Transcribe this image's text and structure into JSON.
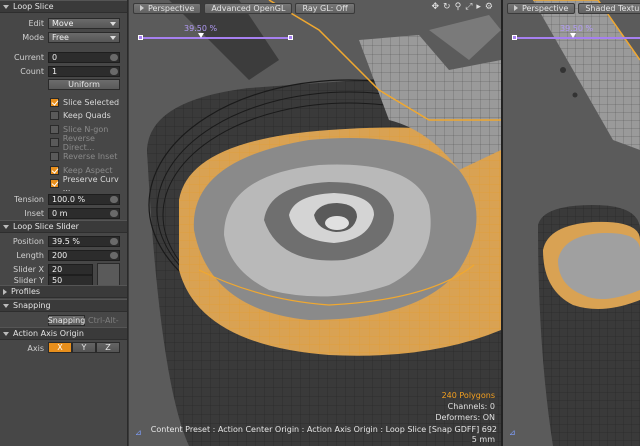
{
  "panel": {
    "loop_slice": {
      "title": "Loop Slice",
      "edit_label": "Edit",
      "edit_value": "Move",
      "mode_label": "Mode",
      "mode_value": "Free",
      "current_label": "Current",
      "current_value": "0",
      "count_label": "Count",
      "count_value": "1",
      "uniform_label": "Uniform",
      "checks": [
        {
          "label": "Slice Selected",
          "checked": true,
          "enabled": true
        },
        {
          "label": "Keep Quads",
          "checked": false,
          "enabled": true
        },
        {
          "label": "Slice N-gon",
          "checked": false,
          "enabled": false
        },
        {
          "label": "Reverse Direct...",
          "checked": false,
          "enabled": false
        },
        {
          "label": "Reverse Inset",
          "checked": false,
          "enabled": false
        },
        {
          "label": "Keep Aspect",
          "checked": true,
          "enabled": false
        },
        {
          "label": "Preserve Curv ...",
          "checked": true,
          "enabled": true
        }
      ],
      "tension_label": "Tension",
      "tension_value": "100.0 %",
      "inset_label": "Inset",
      "inset_value": "0 m"
    },
    "loop_slice_slider": {
      "title": "Loop Slice Slider",
      "position_label": "Position",
      "position_value": "39.5 %",
      "length_label": "Length",
      "length_value": "200",
      "slider_x_label": "Slider X",
      "slider_x_value": "20",
      "slider_y_label": "Slider Y",
      "slider_y_value": "50"
    },
    "profiles": {
      "title": "Profiles"
    },
    "snapping": {
      "title": "Snapping",
      "button_label": "Snapping",
      "shortcut": "Ctrl-Alt-"
    },
    "action_axis": {
      "title": "Action Axis Origin",
      "axis_label": "Axis",
      "axes": [
        "X",
        "Y",
        "Z"
      ],
      "active_axis": "X"
    }
  },
  "viewport_main": {
    "view_label": "Perspective",
    "shading_label": "Advanced OpenGL",
    "raygl_label": "Ray GL: Off",
    "slider_value": "39.50 %",
    "icons": [
      "axes-icon",
      "rotate-icon",
      "zoom-icon",
      "maximize-icon",
      "fit-icon",
      "gear-icon"
    ],
    "polygons": "240 Polygons",
    "channels": "Channels: 0",
    "deformers": "Deformers: ON",
    "status": "Content Preset : Action Center Origin : Action Axis Origin : Loop Slice  [Snap GDFF] 692",
    "scale": "5 mm"
  },
  "viewport_side": {
    "view_label": "Perspective",
    "shading_label": "Shaded Texture",
    "slider_value": "39.50 %"
  },
  "colors": {
    "accent": "#e88f1c",
    "slider": "#a680f0",
    "selection": "#f0a830"
  }
}
